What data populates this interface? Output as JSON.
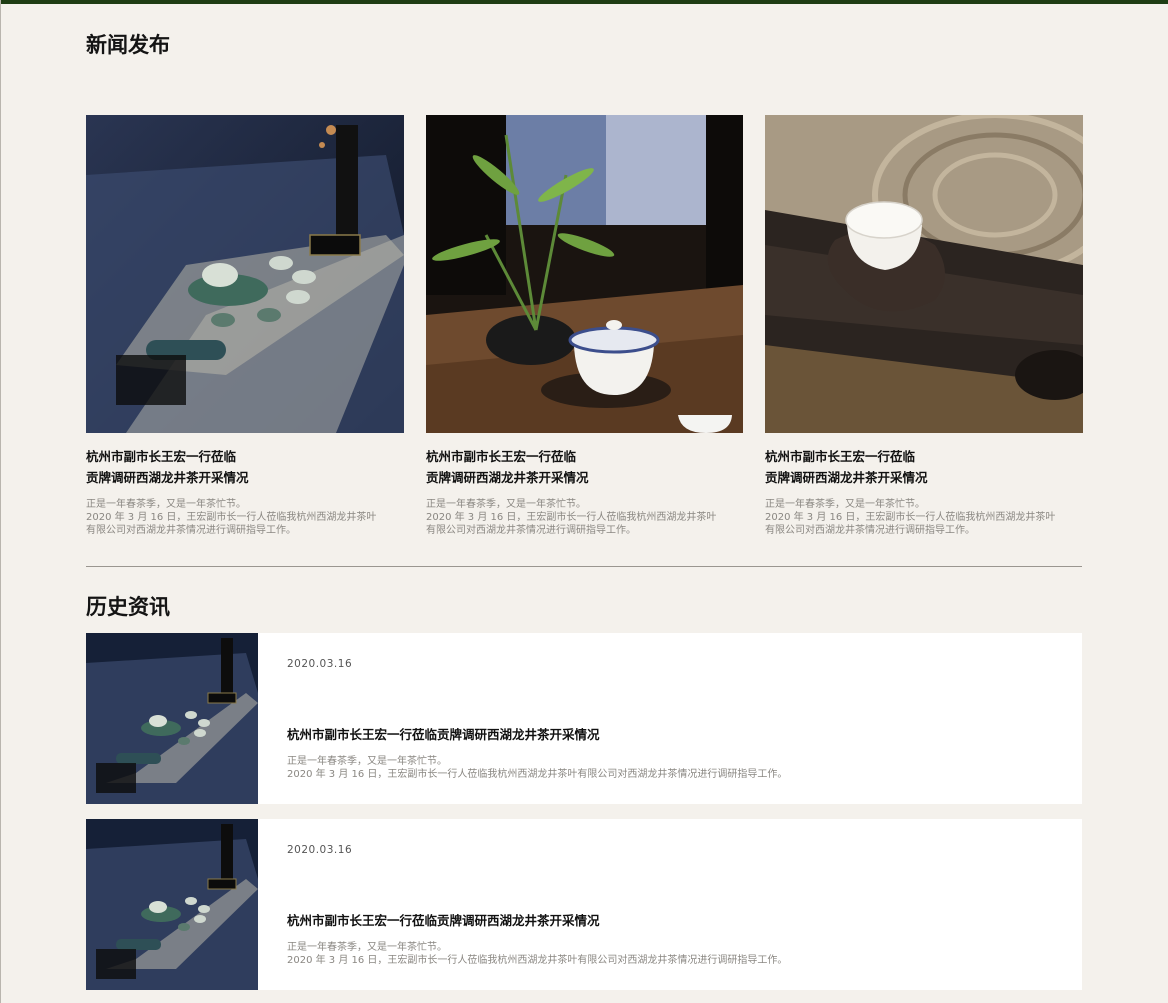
{
  "news_section": {
    "title": "新闻发布",
    "cards": [
      {
        "image": "tea-set-on-blue-cloth",
        "title_line1": "杭州市副市长王宏一行莅临",
        "title_line2": "贡牌调研西湖龙井茶开采情况",
        "desc_line1": "正是一年春茶季，又是一年茶忙节。",
        "desc_line2": "2020 年 3 月 16 日，王宏副市长一行人莅临我杭州西湖龙井茶叶有限公司对西湖龙井茶情况进行调研指导工作。"
      },
      {
        "image": "gaiwan-with-bamboo",
        "title_line1": "杭州市副市长王宏一行莅临",
        "title_line2": "贡牌调研西湖龙井茶开采情况",
        "desc_line1": "正是一年春茶季，又是一年茶忙节。",
        "desc_line2": "2020 年 3 月 16 日，王宏副市长一行人莅临我杭州西湖龙井茶叶有限公司对西湖龙井茶情况进行调研指导工作。"
      },
      {
        "image": "teacup-on-dark-wood",
        "title_line1": "杭州市副市长王宏一行莅临",
        "title_line2": "贡牌调研西湖龙井茶开采情况",
        "desc_line1": "正是一年春茶季，又是一年茶忙节。",
        "desc_line2": "2020 年 3 月 16 日，王宏副市长一行人莅临我杭州西湖龙井茶叶有限公司对西湖龙井茶情况进行调研指导工作。"
      }
    ]
  },
  "history_section": {
    "title": "历史资讯",
    "items": [
      {
        "date": "2020.03.16",
        "title": "杭州市副市长王宏一行莅临贡牌调研西湖龙井茶开采情况",
        "desc_line1": "正是一年春茶季，又是一年茶忙节。",
        "desc_line2": "2020 年 3 月 16 日，王宏副市长一行人莅临我杭州西湖龙井茶叶有限公司对西湖龙井茶情况进行调研指导工作。"
      },
      {
        "date": "2020.03.16",
        "title": "杭州市副市长王宏一行莅临贡牌调研西湖龙井茶开采情况",
        "desc_line1": "正是一年春茶季，又是一年茶忙节。",
        "desc_line2": "2020 年 3 月 16 日，王宏副市长一行人莅临我杭州西湖龙井茶叶有限公司对西湖龙井茶情况进行调研指导工作。"
      }
    ]
  },
  "colors": {
    "top_bar": "#1e3d14",
    "page_bg": "#f4f1ec",
    "title_text": "#141414",
    "muted_text": "#8a8782"
  }
}
